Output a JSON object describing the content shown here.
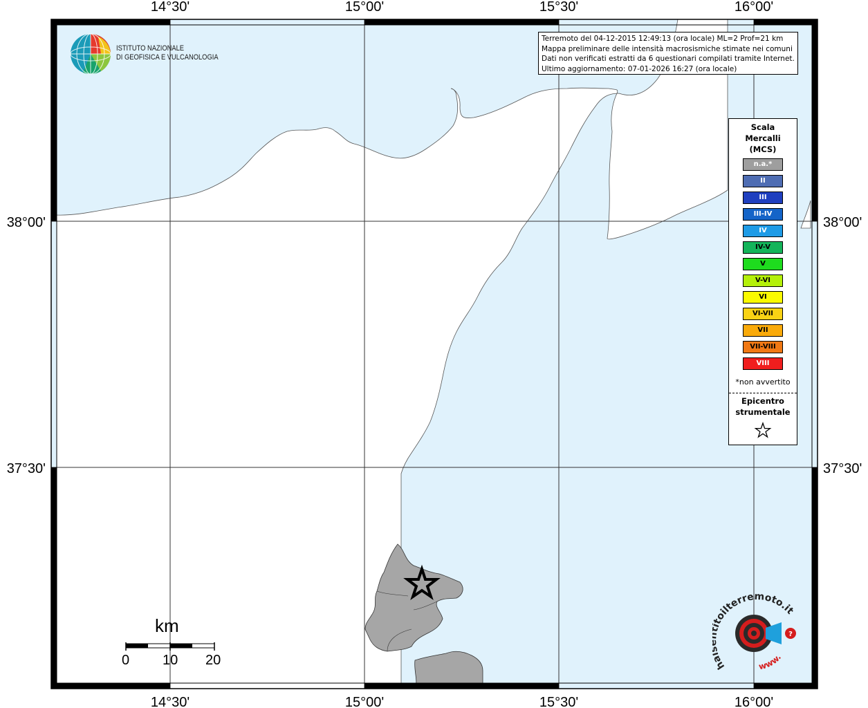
{
  "map": {
    "lon_labels": [
      "14°30'",
      "15°00'",
      "15°30'",
      "16°00'"
    ],
    "lat_labels": [
      "38°00'",
      "37°30'"
    ]
  },
  "info": {
    "line1": "Terremoto del 04-12-2015 12:49:13 (ora locale) ML=2 Prof=21 km",
    "line2": "Mappa preliminare delle intensità macrosismiche stimate nei comuni",
    "line3": "Dati non verificati estratti da 6 questionari compilati tramite Internet.",
    "line4": "Ultimo aggiornamento: 07-01-2026 16:27 (ora locale)"
  },
  "legend": {
    "title1": "Scala",
    "title2": "Mercalli",
    "title3": "(MCS)",
    "items": [
      {
        "label": "n.a.*",
        "color": "#9e9e9e",
        "text_color": "#ffffff"
      },
      {
        "label": "II",
        "color": "#4f6db3",
        "text_color": "#ffffff"
      },
      {
        "label": "III",
        "color": "#1f3fbf",
        "text_color": "#ffffff"
      },
      {
        "label": "III-IV",
        "color": "#1464c8",
        "text_color": "#ffffff"
      },
      {
        "label": "IV",
        "color": "#1e9be6",
        "text_color": "#ffffff"
      },
      {
        "label": "IV-V",
        "color": "#14b45a",
        "text_color": "#000000"
      },
      {
        "label": "V",
        "color": "#1edc1e",
        "text_color": "#000000"
      },
      {
        "label": "V-VI",
        "color": "#b4f00a",
        "text_color": "#000000"
      },
      {
        "label": "VI",
        "color": "#fafa00",
        "text_color": "#000000"
      },
      {
        "label": "VI-VII",
        "color": "#fad214",
        "text_color": "#000000"
      },
      {
        "label": "VII",
        "color": "#faaa0a",
        "text_color": "#000000"
      },
      {
        "label": "VII-VIII",
        "color": "#f07814",
        "text_color": "#000000"
      },
      {
        "label": "VIII",
        "color": "#f01e1e",
        "text_color": "#ffffff"
      }
    ],
    "note": "*non avvertito",
    "epicenter1": "Epicentro",
    "epicenter2": "strumentale"
  },
  "scale_bar": {
    "unit": "km",
    "ticks": [
      "0",
      "10",
      "20"
    ]
  },
  "logos": {
    "ingv_line1": "ISTITUTO NAZIONALE",
    "ingv_line2": "DI GEOFISICA E VULCANOLOGIA",
    "hsit_text": "haisentitoilterremoto.it",
    "hsit_prefix": "www."
  },
  "colors": {
    "sea": "#e0f2fc",
    "land": "#ffffff",
    "felt_area": "#a6a6a6",
    "frame": "#000000"
  }
}
